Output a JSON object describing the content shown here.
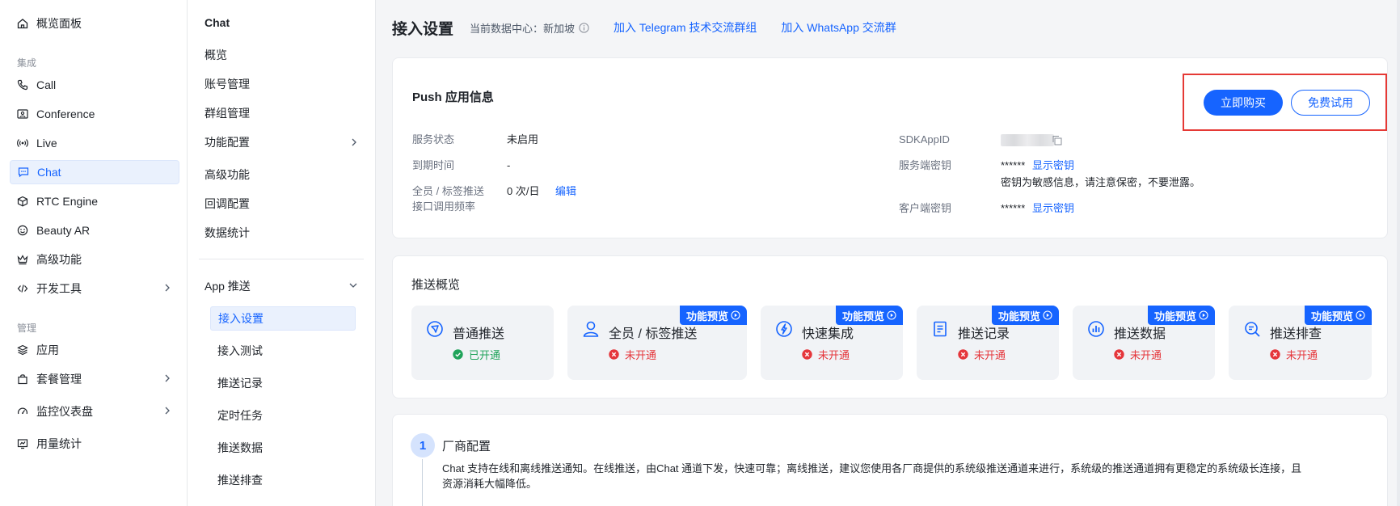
{
  "sidebar": {
    "items": [
      {
        "label": "概览面板",
        "icon": "home-icon"
      },
      {
        "group": "集成"
      },
      {
        "label": "Call",
        "icon": "phone-icon"
      },
      {
        "label": "Conference",
        "icon": "conference-icon"
      },
      {
        "label": "Live",
        "icon": "live-icon"
      },
      {
        "label": "Chat",
        "icon": "chat-icon",
        "active": true
      },
      {
        "label": "RTC Engine",
        "icon": "cube-icon"
      },
      {
        "label": "Beauty AR",
        "icon": "smile-icon"
      },
      {
        "label": "高级功能",
        "icon": "crown-icon"
      },
      {
        "label": "开发工具",
        "icon": "code-icon",
        "expandable": true
      },
      {
        "group": "管理"
      },
      {
        "label": "应用",
        "icon": "layers-icon"
      },
      {
        "label": "套餐管理",
        "icon": "bag-icon",
        "expandable": true
      },
      {
        "label": "监控仪表盘",
        "icon": "gauge-icon",
        "expandable": true
      },
      {
        "label": "用量统计",
        "icon": "chart-icon"
      }
    ]
  },
  "subnav": {
    "title": "Chat",
    "items": [
      "概览",
      "账号管理",
      "群组管理",
      "功能配置",
      "高级功能",
      "回调配置",
      "数据统计"
    ],
    "push_section": "App 推送",
    "push_items": [
      "接入设置",
      "接入测试",
      "推送记录",
      "定时任务",
      "推送数据",
      "推送排查"
    ]
  },
  "header": {
    "title": "接入设置",
    "datacenter": "当前数据中心：新加坡",
    "telegram_link": "加入 Telegram 技术交流群组",
    "whatsapp_link": "加入 WhatsApp 交流群"
  },
  "push_info": {
    "title": "Push 应用信息",
    "buy_label": "立即购买",
    "trial_label": "免费试用",
    "service_status_label": "服务状态",
    "service_status_value": "未启用",
    "expire_label": "到期时间",
    "expire_value": "-",
    "rate_label_1": "全员 / 标签推送",
    "rate_label_2": "接口调用频率",
    "rate_value": "0 次/日",
    "edit_label": "编辑",
    "sdkappid_label": "SDKAppID",
    "server_key_label": "服务端密钥",
    "server_key_value": "******",
    "show_key_label": "显示密钥",
    "key_notice": "密钥为敏感信息，请注意保密，不要泄露。",
    "client_key_label": "客户端密钥",
    "client_key_value": "******",
    "show_client_key_label": "显示密钥"
  },
  "overview": {
    "title": "推送概览",
    "badge": "功能预览",
    "features": [
      {
        "name": "普通推送",
        "status": "已开通",
        "enabled": true,
        "icon": "send-icon"
      },
      {
        "name": "全员 / 标签推送",
        "status": "未开通",
        "enabled": false,
        "icon": "user-icon"
      },
      {
        "name": "快速集成",
        "status": "未开通",
        "enabled": false,
        "icon": "lightning-icon"
      },
      {
        "name": "推送记录",
        "status": "未开通",
        "enabled": false,
        "icon": "document-icon"
      },
      {
        "name": "推送数据",
        "status": "未开通",
        "enabled": false,
        "icon": "bar-chart-icon"
      },
      {
        "name": "推送排查",
        "status": "未开通",
        "enabled": false,
        "icon": "search-doc-icon"
      }
    ]
  },
  "vendor": {
    "step": "1",
    "title": "厂商配置",
    "desc_line1": "Chat 支持在线和离线推送通知。在线推送，由Chat 通道下发，快速可靠；离线推送，建议您使用各厂商提供的系统级推送通道来进行，系统级的推送通道拥有更稳定的系统级长连接，且",
    "desc_line2": "资源消耗大幅降低。"
  },
  "colors": {
    "accent": "#1664ff",
    "success": "#20a35a",
    "danger": "#e5363b",
    "highlight_box": "#e53935"
  }
}
